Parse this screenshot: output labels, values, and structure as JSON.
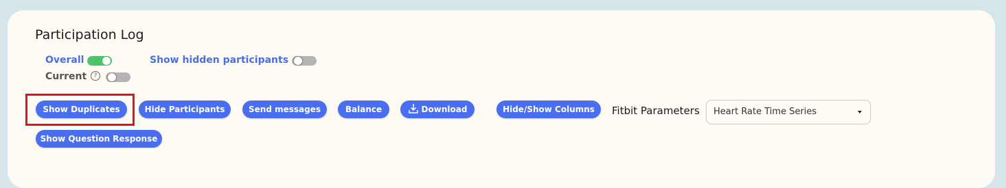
{
  "title": "Participation Log",
  "toggles": {
    "overall": {
      "label": "Overall",
      "state": "on"
    },
    "current": {
      "label": "Current",
      "help": "?",
      "state": "off"
    },
    "hidden": {
      "label": "Show hidden participants",
      "state": "off"
    }
  },
  "buttons": {
    "show_duplicates": "Show Duplicates",
    "hide_participants": "Hide Participants",
    "send_messages": "Send messages",
    "balance": "Balance",
    "download": "Download",
    "hide_show_columns": "Hide/Show Columns",
    "show_question_response": "Show Question Response"
  },
  "fitbit": {
    "label": "Fitbit Parameters",
    "selected": "Heart Rate Time Series"
  },
  "colors": {
    "accent": "#4a6ef0",
    "toggle_on": "#4cc46b",
    "highlight": "#d9161b"
  }
}
